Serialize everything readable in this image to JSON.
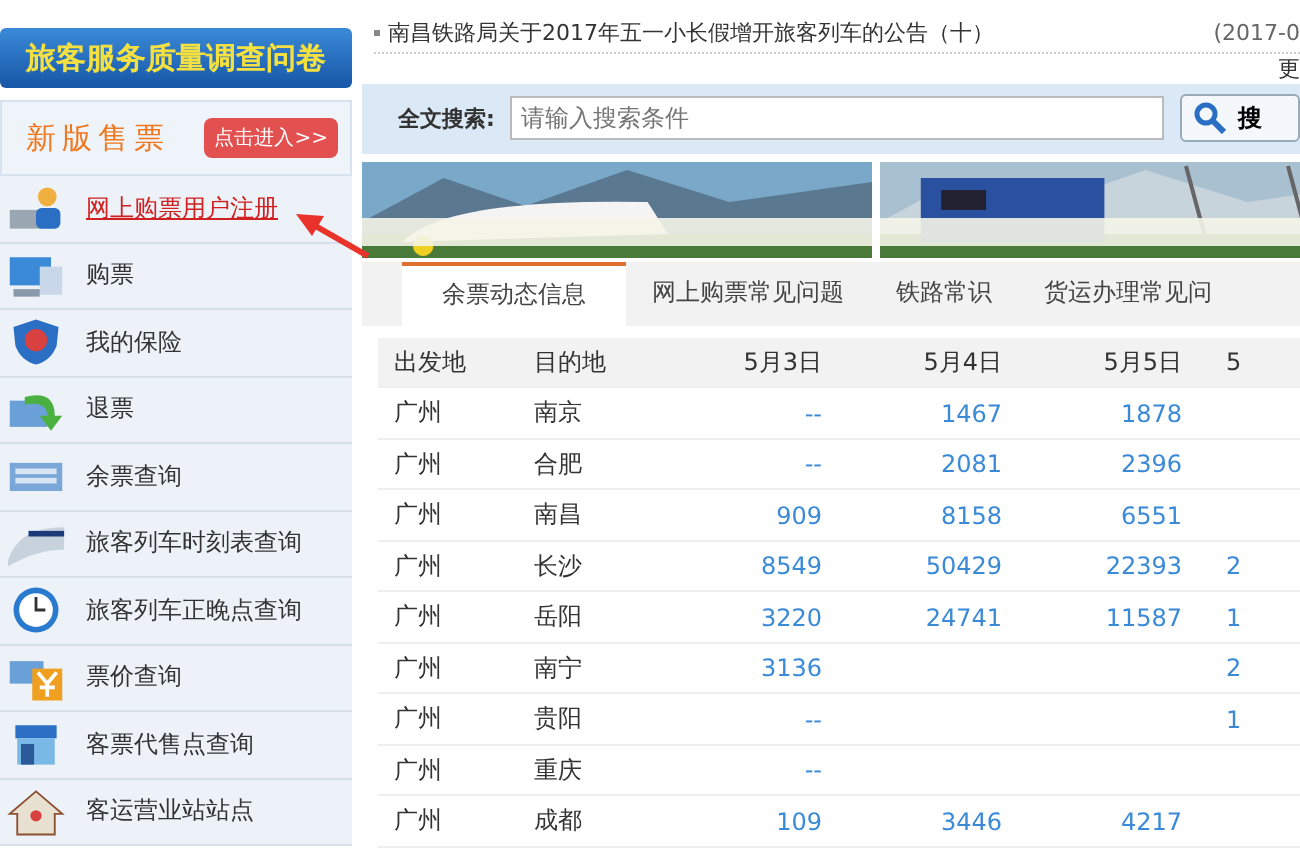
{
  "survey_banner": {
    "label": "旅客服务质量调查问卷"
  },
  "new_sales": {
    "title": "新版售票",
    "button": "点击进入>>"
  },
  "sidebar": {
    "items": [
      {
        "label": "网上购票用户注册",
        "selected": true
      },
      {
        "label": "购票",
        "selected": false
      },
      {
        "label": "我的保险",
        "selected": false
      },
      {
        "label": "退票",
        "selected": false
      },
      {
        "label": "余票查询",
        "selected": false
      },
      {
        "label": "旅客列车时刻表查询",
        "selected": false
      },
      {
        "label": "旅客列车正晚点查询",
        "selected": false
      },
      {
        "label": "票价查询",
        "selected": false
      },
      {
        "label": "客票代售点查询",
        "selected": false
      },
      {
        "label": "客运营业站站点",
        "selected": false
      }
    ]
  },
  "notices": {
    "items": [
      {
        "title": "南昌铁路局关于2017年五一小长假增开旅客列车的公告（十）",
        "date": "(2017-0"
      }
    ],
    "more": "更"
  },
  "search": {
    "label": "全文搜索:",
    "placeholder": "请输入搜索条件",
    "button": "搜"
  },
  "tabs": [
    {
      "label": "余票动态信息",
      "selected": true
    },
    {
      "label": "网上购票常见问题",
      "selected": false
    },
    {
      "label": "铁路常识",
      "selected": false
    },
    {
      "label": "货运办理常见问",
      "selected": false
    }
  ],
  "table": {
    "columns": [
      "出发地",
      "目的地",
      "5月3日",
      "5月4日",
      "5月5日",
      "5"
    ],
    "rows": [
      [
        "广州",
        "南京",
        "--",
        "1467",
        "1878",
        ""
      ],
      [
        "广州",
        "合肥",
        "--",
        "2081",
        "2396",
        ""
      ],
      [
        "广州",
        "南昌",
        "909",
        "8158",
        "6551",
        ""
      ],
      [
        "广州",
        "长沙",
        "8549",
        "50429",
        "22393",
        "2"
      ],
      [
        "广州",
        "岳阳",
        "3220",
        "24741",
        "11587",
        "1"
      ],
      [
        "广州",
        "南宁",
        "3136",
        "",
        "",
        "2"
      ],
      [
        "广州",
        "贵阳",
        "--",
        "",
        "",
        "1"
      ],
      [
        "广州",
        "重庆",
        "--",
        "",
        "",
        ""
      ],
      [
        "广州",
        "成都",
        "109",
        "3446",
        "4217",
        ""
      ]
    ]
  },
  "annotation": {
    "kind": "arrow"
  }
}
